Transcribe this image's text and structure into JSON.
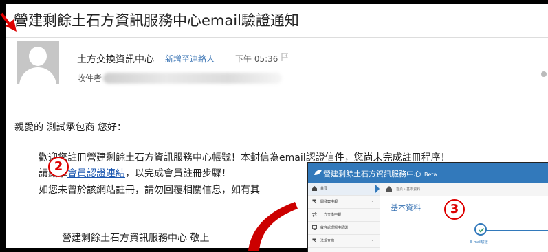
{
  "email": {
    "subject": "營建剩餘土石方資訊服務中心email驗證通知",
    "sender": "土方交換資訊中心",
    "add_contact": "新增至連絡人",
    "time": "下午 05:36",
    "recipient_label": "收件者",
    "greeting": "親愛的 測試承包商 您好：",
    "line1": "歡迎您註冊營建剩餘土石方資訊服務中心帳號！本封信為email認證信件，您尚未完成註冊程序！",
    "line2_prefix": "請點擊",
    "line2_link": "會員認證連結",
    "line2_suffix": "，以完成會員註冊步驟！",
    "line3": "如您未曾於該網站註冊，請勿回覆相關信息，如有其",
    "signature": "營建剩餘土石方資訊服務中心 敬上"
  },
  "badges": {
    "two": "2",
    "three": "3"
  },
  "inset": {
    "app_title": "營建剩餘土石方資訊服務中心",
    "beta": "Beta",
    "sidebar": [
      {
        "label": "首頁",
        "icon": "home-icon",
        "chevron": ""
      },
      {
        "label": "開發案申報",
        "icon": "hammer-icon",
        "chevron": "⌄"
      },
      {
        "label": "土方交換申報",
        "icon": "exchange-icon",
        "chevron": ""
      },
      {
        "label": "收容處理場申請與",
        "icon": "monitor-icon",
        "chevron": ""
      },
      {
        "label": "法規查詢",
        "icon": "hammer-icon",
        "chevron": "⌄"
      }
    ],
    "breadcrumb": "首頁 › 基本資料",
    "panel_title": "基本資料",
    "step_label": "E-mail驗證"
  },
  "colors": {
    "accent": "#3279bb",
    "link": "#1a56b0",
    "badge": "#dd0000"
  }
}
